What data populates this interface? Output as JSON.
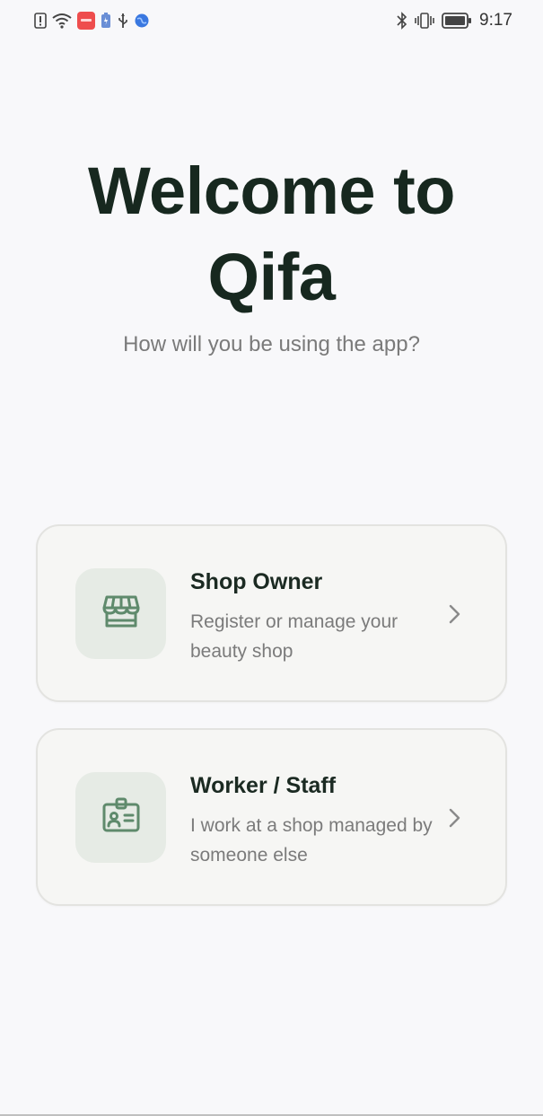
{
  "status_bar": {
    "time": "9:17",
    "left_icons": [
      "alert-icon",
      "wifi-icon",
      "app-notification-icon",
      "battery-saver-icon",
      "usb-icon",
      "browser-icon"
    ],
    "right_icons": [
      "bluetooth-icon",
      "vibrate-icon",
      "battery-icon"
    ]
  },
  "welcome": {
    "title_line1": "Welcome to",
    "title_line2": "Qifa",
    "subtitle": "How will you be using the app?"
  },
  "options": [
    {
      "title": "Shop Owner",
      "description": "Register or manage your beauty shop",
      "icon": "storefront-icon"
    },
    {
      "title": "Worker / Staff",
      "description": "I work at a shop managed by someone else",
      "icon": "id-badge-icon"
    }
  ],
  "colors": {
    "background": "#f8f8fa",
    "title": "#17281f",
    "accent_green": "#5f8a6c",
    "icon_bg": "#e6ebe5",
    "card_bg": "#f6f6f4",
    "muted_text": "#7b7b7b"
  }
}
